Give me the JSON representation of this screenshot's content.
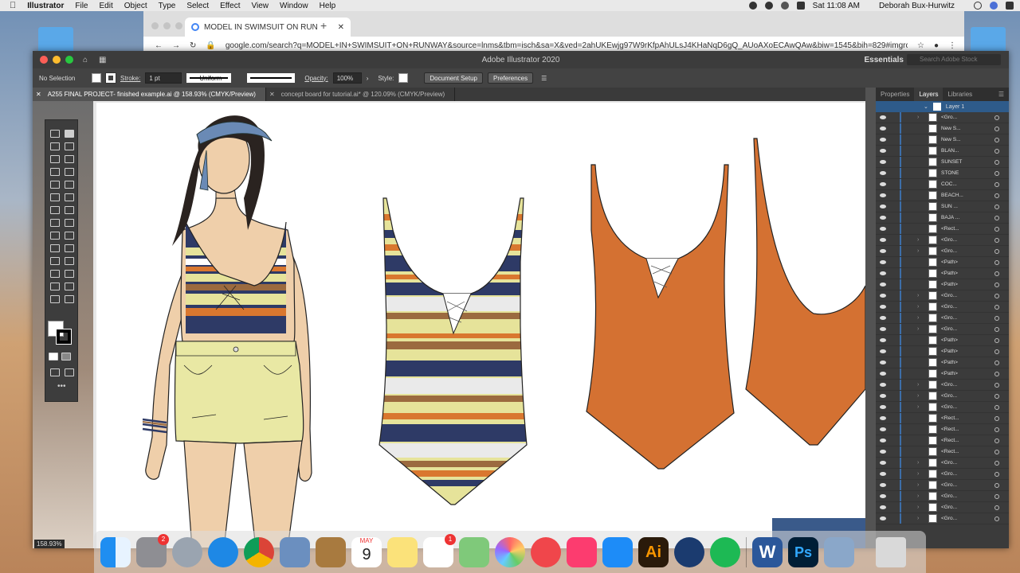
{
  "menubar": {
    "apple": "",
    "items": [
      "Illustrator",
      "File",
      "Edit",
      "Object",
      "Type",
      "Select",
      "Effect",
      "View",
      "Window",
      "Help"
    ],
    "clock": "Sat 11:08 AM",
    "user": "Deborah Bux-Hurwitz"
  },
  "chrome": {
    "tab_title": "MODEL IN SWIMSUIT ON RUN",
    "url": "google.com/search?q=MODEL+IN+SWIMSUIT+ON+RUNWAY&source=lnms&tbm=isch&sa=X&ved=2ahUKEwjg97W9rKfpAhULsJ4KHaNqD6gQ_AUoAXoECAwQAw&biw=1545&bih=829#imgrc=F..."
  },
  "illustrator": {
    "title": "Adobe Illustrator 2020",
    "workspace": "Essentials",
    "stock_placeholder": "Search Adobe Stock",
    "control": {
      "selection": "No Selection",
      "stroke_label": "Stroke:",
      "stroke_value": "1 pt",
      "profile": "Uniform",
      "opacity_label": "Opacity:",
      "opacity_value": "100%",
      "style_label": "Style:",
      "doc_setup": "Document Setup",
      "preferences": "Preferences"
    },
    "doc_tabs": [
      {
        "label": "A255 FINAL PROJECT- finished example.ai @ 158.93% (CMYK/Preview)",
        "active": true
      },
      {
        "label": "concept board for tutorial.ai* @ 120.09% (CMYK/Preview)",
        "active": false
      }
    ],
    "zoom": "158.93%",
    "panel": {
      "tabs": [
        "Properties",
        "Layers",
        "Libraries"
      ],
      "active_tab": "Layers",
      "layer_name": "Layer 1",
      "rows": [
        "<Gro...",
        "New S...",
        "New S...",
        "BLAN...",
        "SUNSET",
        "STONE",
        "COC...",
        "BEACH...",
        "SUN ...",
        "BAJA ...",
        "<Rect...",
        "<Gro...",
        "<Gro...",
        "<Path>",
        "<Path>",
        "<Path>",
        "<Gro...",
        "<Gro...",
        "<Gro...",
        "<Gro...",
        "<Path>",
        "<Path>",
        "<Path>",
        "<Path>",
        "<Gro...",
        "<Gro...",
        "<Gro...",
        "<Rect...",
        "<Rect...",
        "<Rect...",
        "<Rect...",
        "<Gro...",
        "<Gro...",
        "<Gro...",
        "<Gro...",
        "<Gro...",
        "<Gro..."
      ]
    }
  },
  "dock": {
    "apps": [
      "Finder",
      "System Preferences",
      "Launchpad",
      "Safari",
      "Google Chrome",
      "Preview",
      "Notebook",
      "Calendar",
      "Notes",
      "Reminders",
      "Maps",
      "Photos",
      "News",
      "Music",
      "App Store",
      "Adobe Illustrator",
      "QuickTime Player",
      "Spotify",
      "Microsoft Word",
      "Adobe Photoshop",
      "Image Capture",
      "Trash"
    ],
    "calendar_month": "MAY",
    "calendar_day": "9",
    "sysprefs_badge": "2",
    "reminders_badge": "1",
    "illustrator_label": "Ai",
    "word_label": "W",
    "photoshop_label": "Ps"
  },
  "colors": {
    "stripe_navy": "#2e3a66",
    "stripe_cream": "#e6e39a",
    "stripe_orange": "#d9772f",
    "stripe_brown": "#9b6a3f",
    "suit_orange": "#d47132",
    "skin": "#efcfaa",
    "shorts": "#e9e8a4"
  }
}
